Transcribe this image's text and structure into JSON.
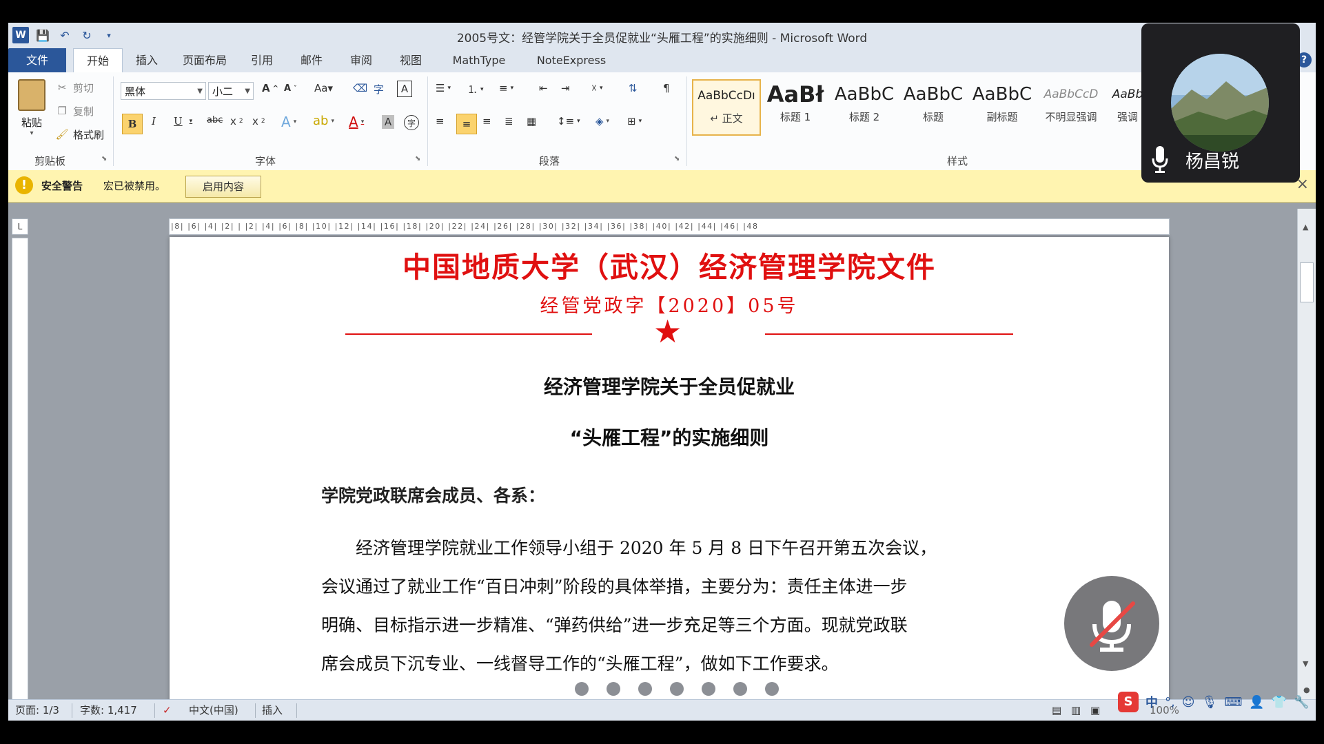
{
  "window": {
    "title": "2005号文：经管学院关于全员促就业“头雁工程”的实施细则 - Microsoft Word"
  },
  "tabs": [
    "文件",
    "开始",
    "插入",
    "页面布局",
    "引用",
    "邮件",
    "审阅",
    "视图",
    "MathType",
    "NoteExpress"
  ],
  "ribbon": {
    "clipboard": {
      "paste": "粘贴",
      "cut": "剪切",
      "copy": "复制",
      "format_painter": "格式刷",
      "label": "剪贴板"
    },
    "font": {
      "font_name": "黑体",
      "font_size": "小二",
      "label": "字体"
    },
    "paragraph": {
      "label": "段落"
    },
    "styles": {
      "label": "样式",
      "items": [
        {
          "sample": "AaBbCcDı",
          "name": "↵ 正文"
        },
        {
          "sample": "AaBł",
          "name": "标题 1"
        },
        {
          "sample": "AaBbC",
          "name": "标题 2"
        },
        {
          "sample": "AaBbC",
          "name": "标题"
        },
        {
          "sample": "AaBbC",
          "name": "副标题"
        },
        {
          "sample": "AaBbCcD",
          "name": "不明显强调"
        },
        {
          "sample": "AaBb",
          "name": "强调"
        }
      ]
    }
  },
  "security_bar": {
    "title": "安全警告",
    "message": "宏已被禁用。",
    "button": "启用内容",
    "close": "×"
  },
  "ruler": {
    "ticks": "|8| |6| |4| |2| |  |2| |4| |6| |8| |10| |12| |14| |16| |18| |20| |22| |24| |26| |28| |30| |32| |34| |36| |38| |40| |42| |44| |46| |48"
  },
  "document": {
    "header": "中国地质大学（武汉）经济管理学院文件",
    "doc_number": "经管党政字【2020】05号",
    "title_line1": "经济管理学院关于全员促就业",
    "title_line2": "“头雁工程”的实施细则",
    "salutation": "学院党政联席会成员、各系：",
    "para1_line1": "经济管理学院就业工作领导小组于 2020 年 5 月 8 日下午召开第五次会议，",
    "para1_line2": "会议通过了就业工作“百日冲刺”阶段的具体举措，主要分为：责任主体进一步",
    "para1_line3": "明确、目标指示进一步精准、“弹药供给”进一步充足等三个方面。现就党政联",
    "para1_line4": "席会成员下沉专业、一线督导工作的“头雁工程”，做如下工作要求。"
  },
  "status_bar": {
    "page": "页面: 1/3",
    "words": "字数: 1,417",
    "language": "中文(中国)",
    "mode": "插入",
    "zoom": "100%"
  },
  "meeting": {
    "participant_name": "杨昌锐"
  },
  "ime": {
    "mode": "中"
  },
  "colors": {
    "word_blue": "#2b579a",
    "doc_red": "#e01010",
    "warning_yellow": "#fff4b0"
  }
}
